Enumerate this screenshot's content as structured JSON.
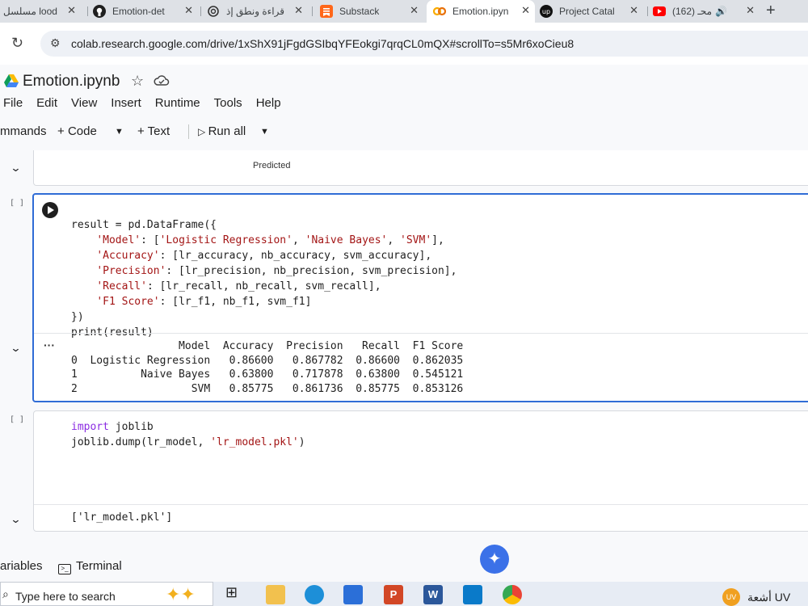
{
  "browser": {
    "tabs": [
      {
        "label": "مسلسل lood",
        "icon": "tab-site-icon"
      },
      {
        "label": "Emotion-det",
        "icon": "github-icon"
      },
      {
        "label": "قراءة ونطق إذ",
        "icon": "openai-icon"
      },
      {
        "label": "Substack",
        "icon": "substack-icon"
      },
      {
        "label": "Emotion.ipyn",
        "icon": "colab-icon"
      },
      {
        "label": "Project Catal",
        "icon": "upwork-icon"
      },
      {
        "label": "(162) محـ",
        "icon": "youtube-icon"
      }
    ],
    "url": "colab.research.google.com/drive/1xShX91jFgdGSIbqYFEokgi7qrqCL0mQX#scrollTo=s5Mr6xoCieu8"
  },
  "colab": {
    "title": "Emotion.ipynb",
    "menu": [
      "File",
      "Edit",
      "View",
      "Insert",
      "Runtime",
      "Tools",
      "Help"
    ],
    "toolbar": {
      "commands": "mmands",
      "code": "Code",
      "text": "Text",
      "run_all": "Run all"
    }
  },
  "cells": {
    "prev_output_label": "Predicted",
    "cell1": {
      "exec_count": "[ ]",
      "code_lines": [
        "result = pd.DataFrame({",
        "    'Model': ['Logistic Regression', 'Naive Bayes', 'SVM'],",
        "    'Accuracy': [lr_accuracy, nb_accuracy, svm_accuracy],",
        "    'Precision': [lr_precision, nb_precision, svm_precision],",
        "    'Recall': [lr_recall, nb_recall, svm_recall],",
        "    'F1 Score': [lr_f1, nb_f1, svm_f1]",
        "})",
        "print(result)"
      ],
      "output": {
        "header": "                 Model  Accuracy  Precision   Recall  F1 Score",
        "rows": [
          "0  Logistic Regression   0.86600   0.867782  0.86600  0.862035",
          "1          Naive Bayes   0.63800   0.717878  0.63800  0.545121",
          "2                  SVM   0.85775   0.861736  0.85775  0.853126"
        ]
      }
    },
    "cell2": {
      "exec_count": "[ ]",
      "code_lines": [
        "import joblib",
        "joblib.dump(lr_model, 'lr_model.pkl')"
      ],
      "output": "['lr_model.pkl']"
    }
  },
  "bottom": {
    "variables": "ariables",
    "terminal": "Terminal"
  },
  "taskbar": {
    "search_placeholder": "Type here to search",
    "tray_label": "أشعة UV",
    "tray_badge": "UV"
  }
}
